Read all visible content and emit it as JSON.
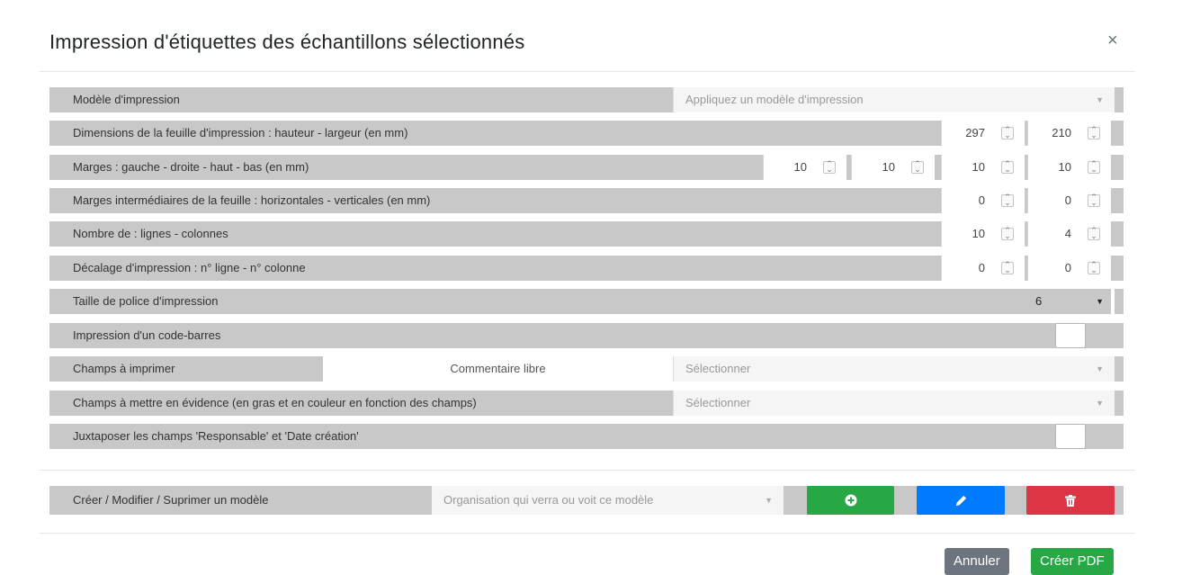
{
  "dialog": {
    "title": "Impression d'étiquettes des échantillons sélectionnés",
    "close_symbol": "×"
  },
  "rows": {
    "template": {
      "label": "Modèle d'impression",
      "placeholder": "Appliquez un modèle d'impression"
    },
    "sheet_dims": {
      "label": "Dimensions de la feuille d'impression : hauteur - largeur (en mm)",
      "height": "297",
      "width": "210"
    },
    "margins": {
      "label": "Marges : gauche - droite - haut - bas (en mm)",
      "left": "10",
      "right": "10",
      "top": "10",
      "bottom": "10"
    },
    "inner_margins": {
      "label": "Marges intermédiaires de la feuille : horizontales - verticales (en mm)",
      "horizontal": "0",
      "vertical": "0"
    },
    "grid": {
      "label": "Nombre de : lignes - colonnes",
      "lines": "10",
      "columns": "4"
    },
    "offset": {
      "label": "Décalage d'impression : n° ligne - n° colonne",
      "line": "0",
      "column": "0"
    },
    "font_size": {
      "label": "Taille de police d'impression",
      "value": "6"
    },
    "barcode": {
      "label": "Impression d'un code-barres",
      "checked": false
    },
    "fields": {
      "label": "Champs à imprimer",
      "free_comment": "Commentaire libre",
      "placeholder": "Sélectionner"
    },
    "highlight": {
      "label": "Champs à mettre en évidence (en gras et en couleur en fonction des champs)",
      "placeholder": "Sélectionner"
    },
    "juxtapose": {
      "label": "Juxtaposer les champs 'Responsable' et 'Date création'",
      "checked": false
    },
    "manage": {
      "label": "Créer / Modifier / Suprimer un modèle",
      "placeholder": "Organisation qui verra ou voit ce modèle",
      "add_icon": "plus-circle-icon",
      "edit_icon": "pencil-icon",
      "delete_icon": "trash-icon",
      "colors": {
        "add": "#28a745",
        "edit": "#007bff",
        "delete": "#dc3545"
      }
    }
  },
  "footer": {
    "cancel_label": "Annuler",
    "create_label": "Créer PDF"
  }
}
